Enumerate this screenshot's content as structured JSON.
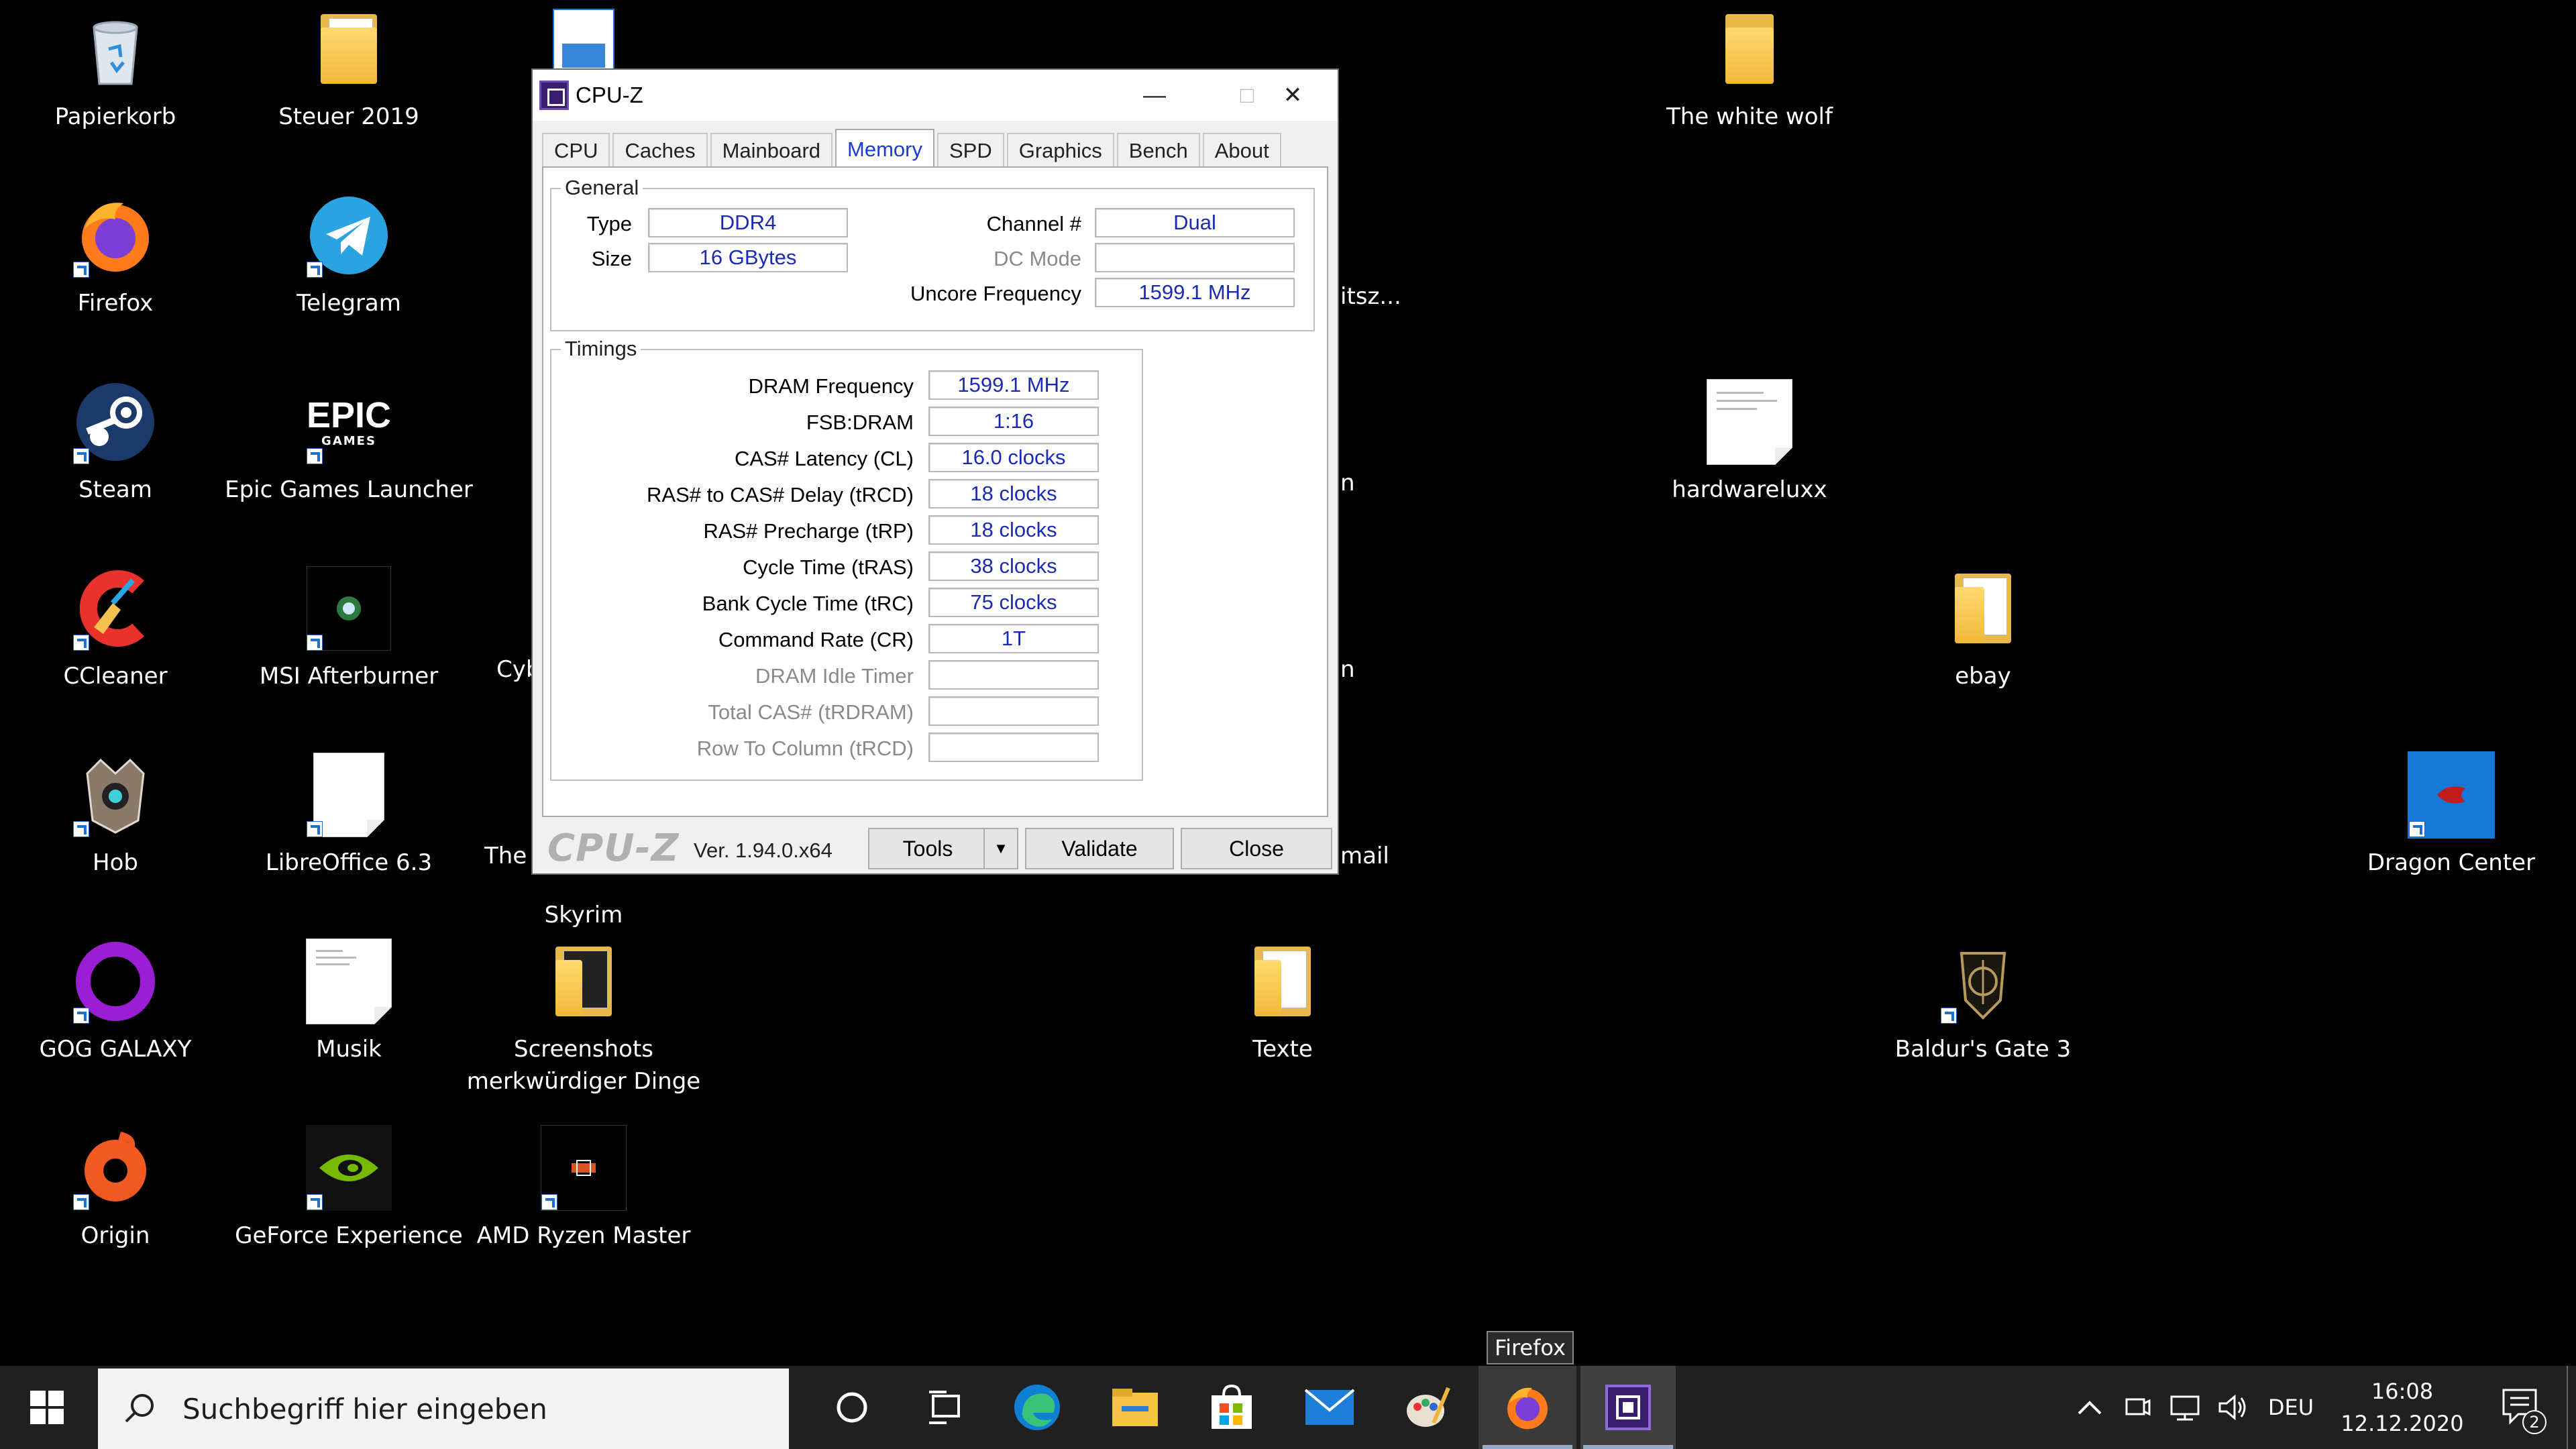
{
  "desktop": {
    "icons": {
      "papierkorb": "Papierkorb",
      "steuer": "Steuer 2019",
      "firefox": "Firefox",
      "telegram": "Telegram",
      "steam": "Steam",
      "epic": "Epic Games Launcher",
      "epic_logo": "EPIC",
      "epic_logo_sub": "GAMES",
      "ccleaner": "CCleaner",
      "msi": "MSI Afterburner",
      "hob": "Hob",
      "libreoffice": "LibreOffice 6.3",
      "gog": "GOG GALAXY",
      "musik": "Musik",
      "screenshots_line1": "Screenshots",
      "screenshots_line2": "merkwürdiger Dinge",
      "origin": "Origin",
      "geforce": "GeForce Experience",
      "ryzen": "AMD Ryzen Master",
      "skyrim": "Skyrim",
      "texte": "Texte",
      "white_wolf": "The white wolf",
      "hardwareluxx": "hardwareluxx",
      "ebay": "ebay",
      "dragon": "Dragon Center",
      "baldur": "Baldur's Gate 3"
    },
    "partials": {
      "itsz": "itsz...",
      "n1": "n",
      "n2": "n",
      "cyb": "Cyb",
      "the": "The",
      "mail": "mail"
    }
  },
  "cpuz": {
    "title": "CPU-Z",
    "tabs": [
      "CPU",
      "Caches",
      "Mainboard",
      "Memory",
      "SPD",
      "Graphics",
      "Bench",
      "About"
    ],
    "active_tab": "Memory",
    "general": {
      "title": "General",
      "type_label": "Type",
      "type_value": "DDR4",
      "size_label": "Size",
      "size_value": "16 GBytes",
      "channel_label": "Channel #",
      "channel_value": "Dual",
      "dcmode_label": "DC Mode",
      "dcmode_value": "",
      "uncore_label": "Uncore Frequency",
      "uncore_value": "1599.1 MHz"
    },
    "timings": {
      "title": "Timings",
      "rows": [
        {
          "label": "DRAM Frequency",
          "value": "1599.1 MHz",
          "enabled": true
        },
        {
          "label": "FSB:DRAM",
          "value": "1:16",
          "enabled": true
        },
        {
          "label": "CAS# Latency (CL)",
          "value": "16.0 clocks",
          "enabled": true
        },
        {
          "label": "RAS# to CAS# Delay (tRCD)",
          "value": "18 clocks",
          "enabled": true
        },
        {
          "label": "RAS# Precharge (tRP)",
          "value": "18 clocks",
          "enabled": true
        },
        {
          "label": "Cycle Time (tRAS)",
          "value": "38 clocks",
          "enabled": true
        },
        {
          "label": "Bank Cycle Time (tRC)",
          "value": "75 clocks",
          "enabled": true
        },
        {
          "label": "Command Rate (CR)",
          "value": "1T",
          "enabled": true
        },
        {
          "label": "DRAM Idle Timer",
          "value": "",
          "enabled": false
        },
        {
          "label": "Total CAS# (tRDRAM)",
          "value": "",
          "enabled": false
        },
        {
          "label": "Row To Column (tRCD)",
          "value": "",
          "enabled": false
        }
      ]
    },
    "footer": {
      "brand": "CPU-Z",
      "version": "Ver. 1.94.0.x64",
      "tools": "Tools",
      "validate": "Validate",
      "close": "Close"
    }
  },
  "taskbar": {
    "search_placeholder": "Suchbegriff hier eingeben",
    "tooltip": "Firefox",
    "language": "DEU",
    "time": "16:08",
    "date": "12.12.2020",
    "notifications": "2"
  }
}
